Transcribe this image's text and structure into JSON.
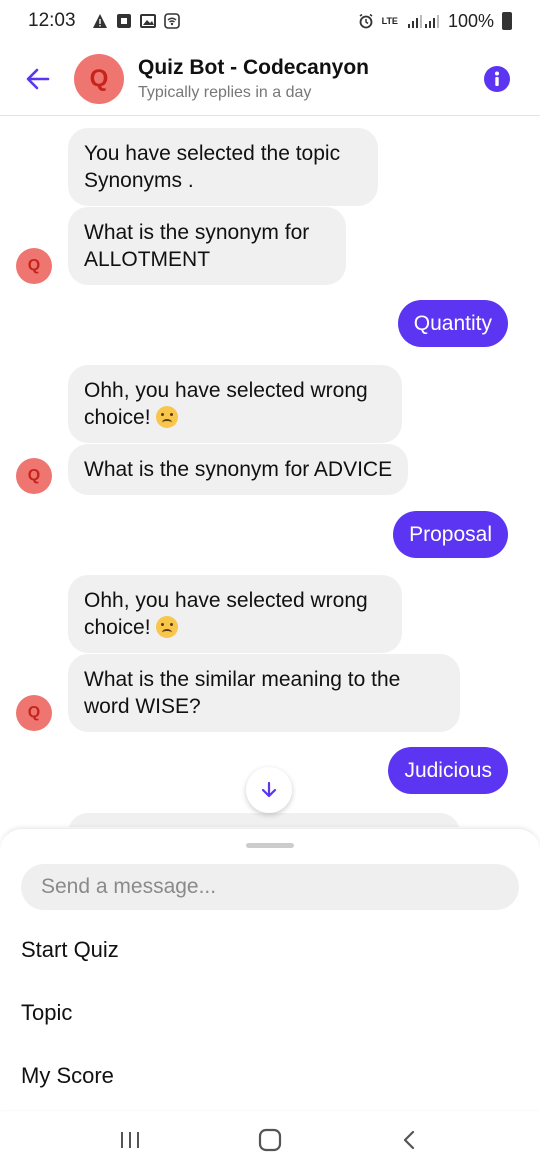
{
  "status": {
    "time": "12:03",
    "left_icons": [
      "alert-icon",
      "square-icon",
      "image-icon",
      "wifi-icon"
    ],
    "network": "LTE",
    "battery": "100%"
  },
  "header": {
    "avatar_letter": "Q",
    "title": "Quiz Bot - Codecanyon",
    "subtitle": "Typically replies in a day"
  },
  "messages": [
    {
      "from": "bot",
      "text": "You have selected the topic Synonyms ."
    },
    {
      "from": "bot",
      "text": "What is the synonym for ALLOTMENT"
    },
    {
      "from": "user",
      "text": "Quantity"
    },
    {
      "from": "bot",
      "text": "Ohh, you have selected wrong choice!",
      "emoji": "frowning-face"
    },
    {
      "from": "bot",
      "text": "What is the synonym for ADVICE"
    },
    {
      "from": "user",
      "text": "Proposal"
    },
    {
      "from": "bot",
      "text": "Ohh, you have selected wrong choice!",
      "emoji": "frowning-face"
    },
    {
      "from": "bot",
      "text": "What is the similar meaning to the word WISE?"
    },
    {
      "from": "user",
      "text": "Judicious"
    }
  ],
  "composer": {
    "placeholder": "Send a message..."
  },
  "quick_replies": [
    "Start Quiz",
    "Topic",
    "My Score"
  ],
  "colors": {
    "accent": "#5b35f2",
    "avatar": "#ef7670",
    "bot_bubble": "#f0f0f0"
  }
}
